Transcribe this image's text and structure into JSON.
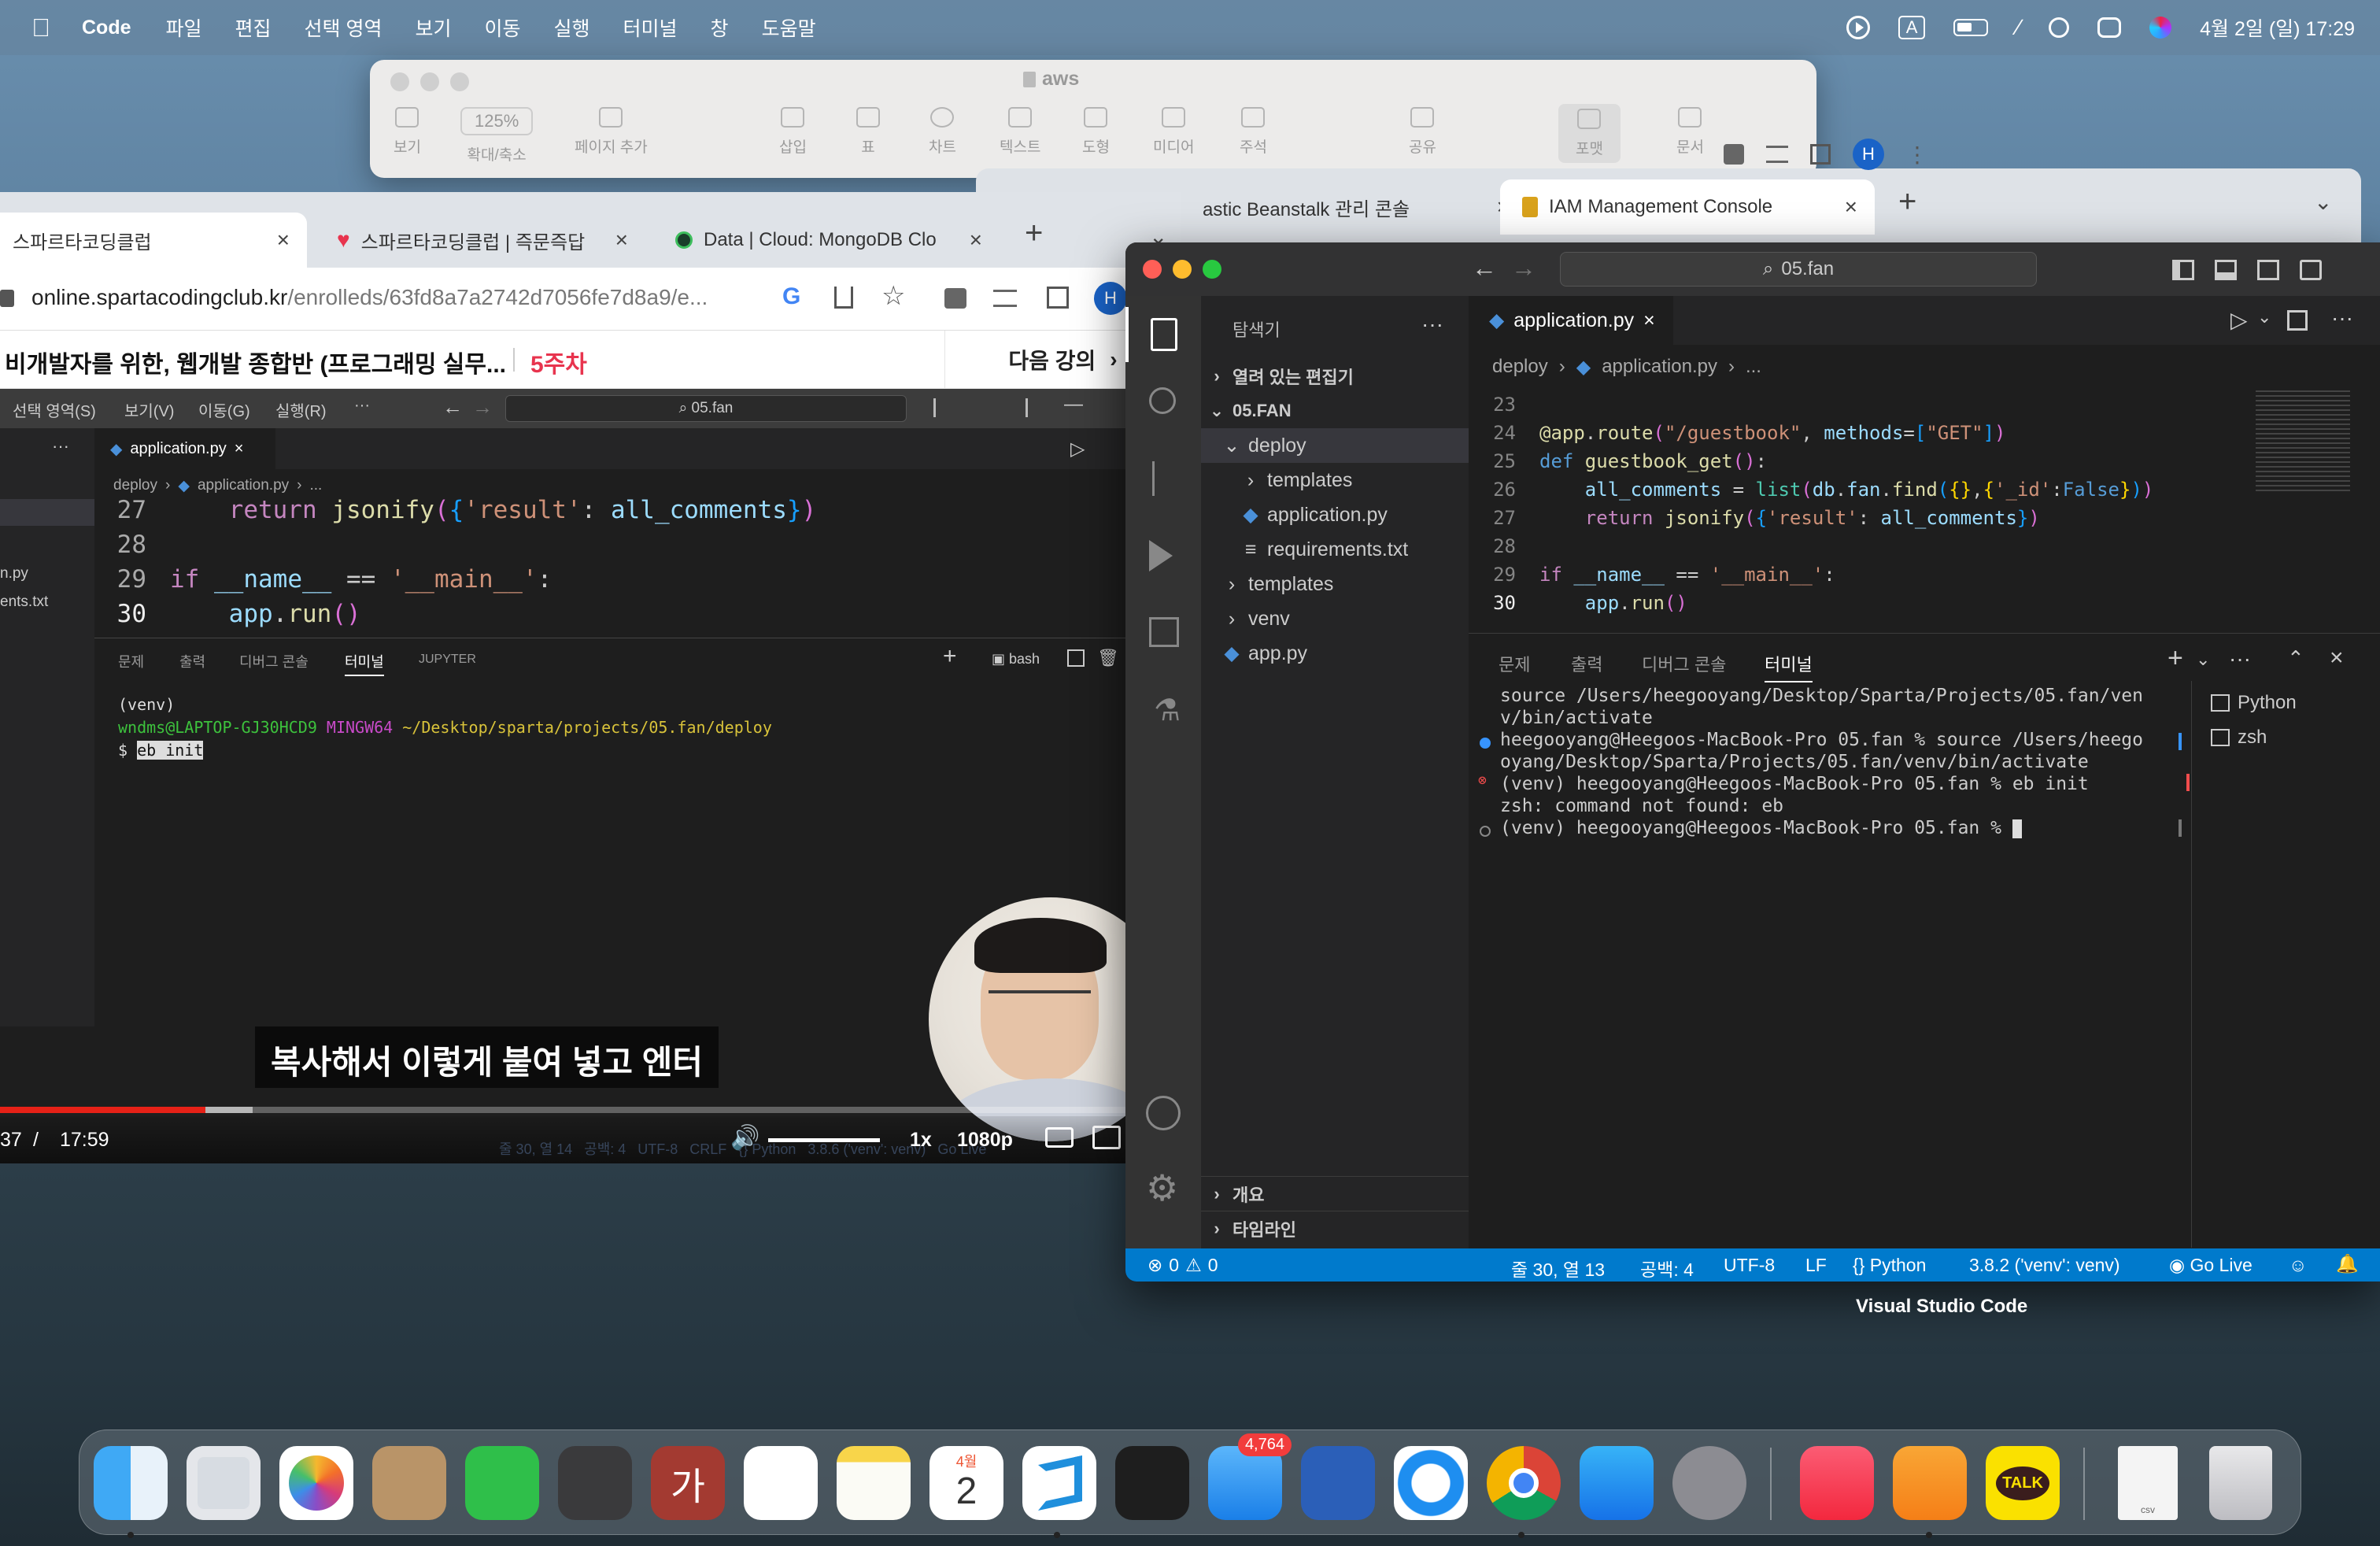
{
  "menubar": {
    "app": "Code",
    "items": [
      "파일",
      "편집",
      "선택 영역",
      "보기",
      "이동",
      "실행",
      "터미널",
      "창",
      "도움말"
    ],
    "input_indicator": "A",
    "datetime": "4월 2일 (일) 17:29"
  },
  "pages": {
    "title": "aws",
    "zoom": "125%",
    "tools": [
      "보기",
      "확대/축소",
      "페이지 추가",
      "삽입",
      "표",
      "차트",
      "텍스트",
      "도형",
      "미디어",
      "주석",
      "공유",
      "포맷",
      "문서"
    ]
  },
  "chrome_back": {
    "tabs": [
      "astic Beanstalk 관리 콘솔",
      "IAM Management Console"
    ],
    "profile": "H"
  },
  "chrome_front": {
    "tabs": [
      "스파르타코딩클럽",
      "스파르타코딩클럽 | 즉문즉답",
      "Data | Cloud: MongoDB Clo"
    ],
    "url_host": "online.spartacodingclub.kr",
    "url_path": "/enrolleds/63fd8a7a2742d7056fe7d8a9/e...",
    "profile": "H",
    "course_title": "비개발자를 위한, 웹개발 종합반 (프로그래밍 실무...",
    "week": "5주차",
    "next_lecture": "다음 강의"
  },
  "video": {
    "menu": [
      "선택 영역(S)",
      "보기(V)",
      "이동(G)",
      "실행(R)",
      "···"
    ],
    "search": "05.fan",
    "tab": "application.py",
    "breadcrumb": [
      "deploy",
      "application.py",
      "..."
    ],
    "side_files": [
      "n.py",
      "ents.txt"
    ],
    "code": [
      {
        "n": "27",
        "text": "    return jsonify({'result': all_comments})"
      },
      {
        "n": "28",
        "text": ""
      },
      {
        "n": "29",
        "text": "if __name__ == '__main__':"
      },
      {
        "n": "30",
        "text": "    app.run()"
      }
    ],
    "panel_tabs": [
      "문제",
      "출력",
      "디버그 콘솔",
      "터미널",
      "JUPYTER"
    ],
    "shell": "bash",
    "terminal": {
      "venv": "(venv)",
      "user": "wndms@LAPTOP-GJ30HCD9",
      "host": "MINGW64",
      "path": "~/Desktop/sparta/projects/05.fan/deploy",
      "prompt": "$",
      "cmd": "eb init"
    },
    "subtitle": "복사해서 이렇게 붙여 넣고 엔터",
    "time_current": "37",
    "time_sep": "/",
    "time_total": "17:59",
    "speed": "1x",
    "quality": "1080p",
    "progress": 0.35,
    "buffered": 0.43,
    "status_ghost": "줄 30, 열 14   공백: 4   UTF-8   CRLF   {} Python   3.8.6 ('venv': venv)   Go Live"
  },
  "vscode": {
    "search": "05.fan",
    "explorer": {
      "title": "탐색기",
      "open_editors": "열려 있는 편집기",
      "root": "05.FAN",
      "items": [
        {
          "label": "deploy",
          "indent": 1,
          "kind": "folder-open"
        },
        {
          "label": "templates",
          "indent": 2,
          "kind": "folder"
        },
        {
          "label": "application.py",
          "indent": 2,
          "kind": "py"
        },
        {
          "label": "requirements.txt",
          "indent": 2,
          "kind": "txt"
        },
        {
          "label": "templates",
          "indent": 1,
          "kind": "folder"
        },
        {
          "label": "venv",
          "indent": 1,
          "kind": "folder"
        },
        {
          "label": "app.py",
          "indent": 1,
          "kind": "py"
        }
      ],
      "outline": "개요",
      "timeline": "타임라인"
    },
    "tab": "application.py",
    "breadcrumb": [
      "deploy",
      "application.py",
      "..."
    ],
    "code": [
      {
        "n": "23",
        "text": ""
      },
      {
        "n": "24",
        "text": "@app.route(\"/guestbook\", methods=[\"GET\"])"
      },
      {
        "n": "25",
        "text": "def guestbook_get():"
      },
      {
        "n": "26",
        "text": "    all_comments = list(db.fan.find({},{'_id':False}))"
      },
      {
        "n": "27",
        "text": "    return jsonify({'result': all_comments})"
      },
      {
        "n": "28",
        "text": ""
      },
      {
        "n": "29",
        "text": "if __name__ == '__main__':"
      },
      {
        "n": "30",
        "text": "    app.run()"
      }
    ],
    "panel_tabs": [
      "문제",
      "출력",
      "디버그 콘솔",
      "터미널"
    ],
    "terminal_lines": [
      "source /Users/heegooyang/Desktop/Sparta/Projects/05.fan/ven",
      "v/bin/activate",
      "heegooyang@Heegoos-MacBook-Pro 05.fan % source /Users/heego",
      "oyang/Desktop/Sparta/Projects/05.fan/venv/bin/activate",
      "(venv) heegooyang@Heegoos-MacBook-Pro 05.fan % eb init",
      "zsh: command not found: eb",
      "(venv) heegooyang@Heegoos-MacBook-Pro 05.fan % "
    ],
    "terminals": [
      "Python",
      "zsh"
    ],
    "status": {
      "errors": "0",
      "warnings": "0",
      "position": "줄 30, 열 13",
      "spaces": "공백: 4",
      "encoding": "UTF-8",
      "eol": "LF",
      "language": "Python",
      "interpreter": "3.8.2 ('venv': venv)",
      "golive": "Go Live"
    },
    "app_label": "Visual Studio Code"
  },
  "dock": {
    "apps": [
      "finder",
      "launchpad",
      "photos",
      "contacts",
      "numbers",
      "calculator",
      "dictionary",
      "reminders",
      "notes",
      "calendar",
      "vscode",
      "figma",
      "mail",
      "sequel",
      "safari",
      "chrome",
      "appstore",
      "settings",
      "music",
      "pages",
      "kakaotalk",
      "csv-file",
      "trash"
    ],
    "mail_badge": "4,764",
    "calendar_month": "4월",
    "calendar_day": "2",
    "dictionary_glyph": "가",
    "kakao_label": "TALK",
    "csv_label": "csv"
  },
  "colors": {
    "vscode_blue": "#007acc",
    "youtube_red": "#e62117",
    "week_red": "#e8344e"
  }
}
